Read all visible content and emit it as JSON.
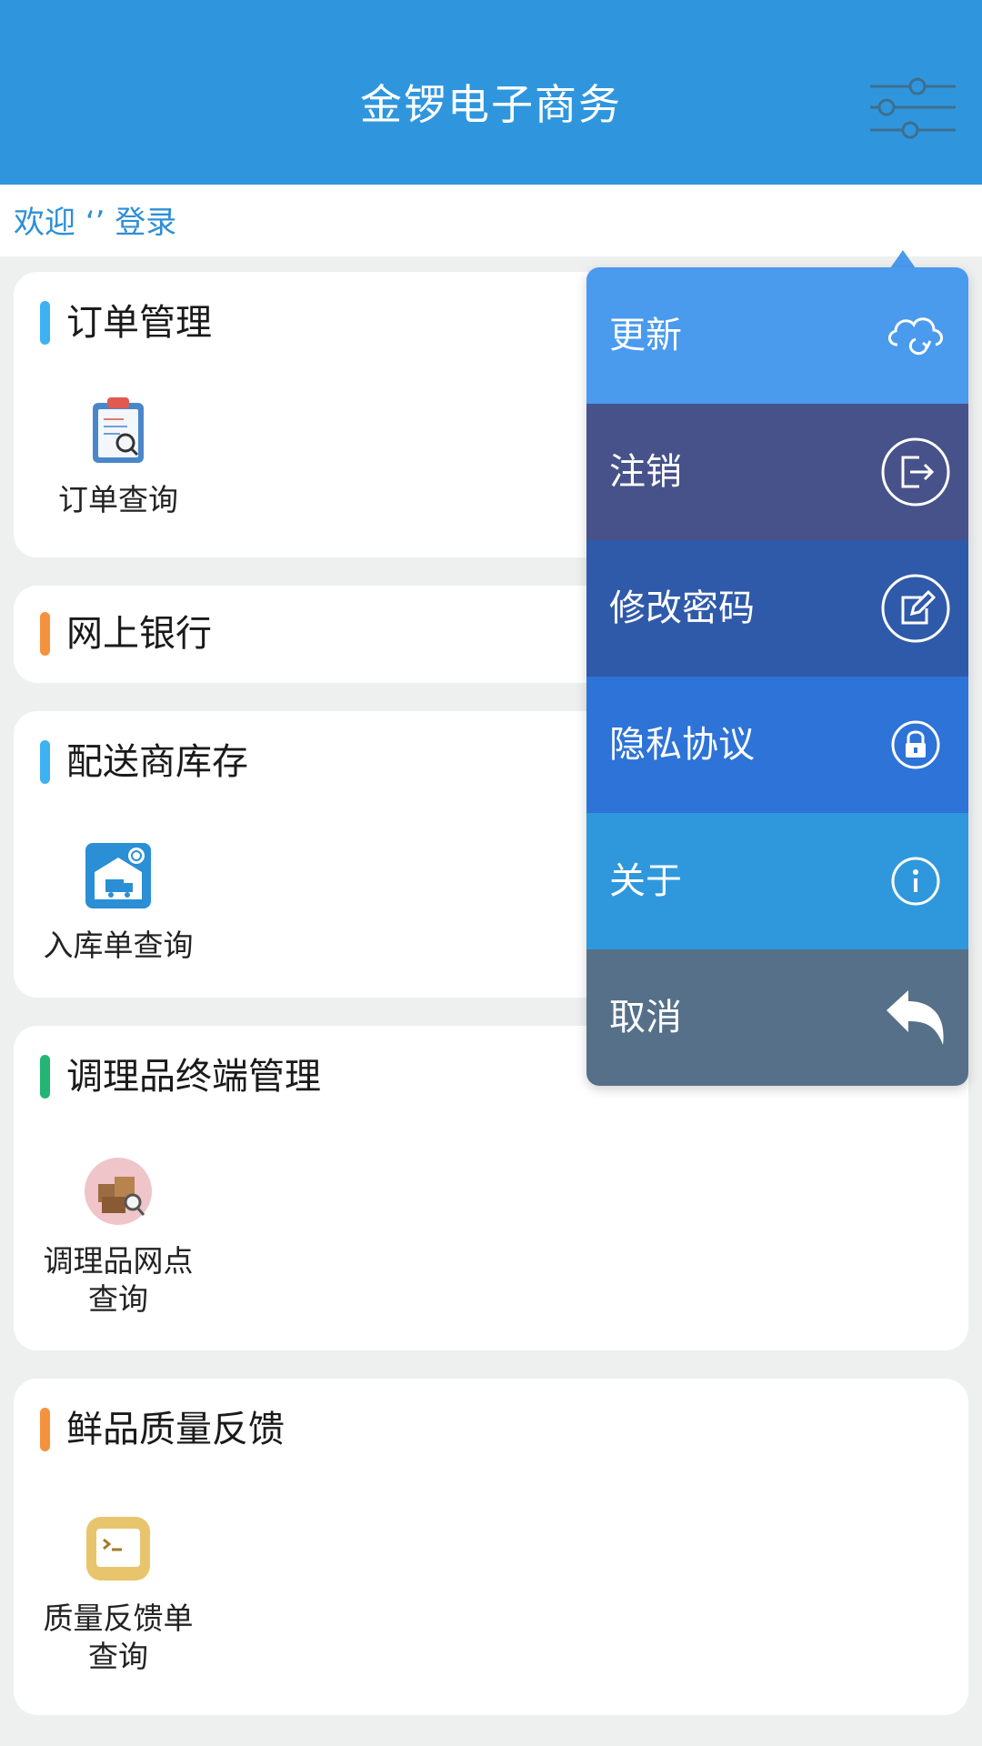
{
  "header": {
    "title": "金锣电子商务",
    "settings_icon": "sliders-icon",
    "background": "#2f96de"
  },
  "welcome": {
    "text": "欢迎 ‘’ 登录",
    "color": "#2f8fd6"
  },
  "sections": [
    {
      "title": "订单管理",
      "accent": "#3db1f2",
      "items": [
        {
          "label": "订单查询",
          "icon": "clipboard-search-icon"
        }
      ]
    },
    {
      "title": "网上银行",
      "accent": "#f5923e",
      "items": []
    },
    {
      "title": "配送商库存",
      "accent": "#3db1f2",
      "items": [
        {
          "label": "入库单查询",
          "icon": "warehouse-truck-icon"
        }
      ]
    },
    {
      "title": "调理品终端管理",
      "accent": "#22b573",
      "items": [
        {
          "label": "调理品网点\n查询",
          "icon": "boxes-search-icon"
        }
      ]
    },
    {
      "title": "鲜品质量反馈",
      "accent": "#f5923e",
      "items": [
        {
          "label": "质量反馈单\n查询",
          "icon": "terminal-icon"
        }
      ]
    }
  ],
  "menu": {
    "items": [
      {
        "label": "更新",
        "icon": "cloud-refresh-icon",
        "color": "#4a9aee"
      },
      {
        "label": "注销",
        "icon": "logout-icon",
        "color": "#465289"
      },
      {
        "label": "修改密码",
        "icon": "edit-icon",
        "color": "#2f5aa9"
      },
      {
        "label": "隐私协议",
        "icon": "lock-icon",
        "color": "#2d73d8"
      },
      {
        "label": "关于",
        "icon": "info-icon",
        "color": "#2f98dc"
      },
      {
        "label": "取消",
        "icon": "undo-icon",
        "color": "#577089"
      }
    ]
  }
}
